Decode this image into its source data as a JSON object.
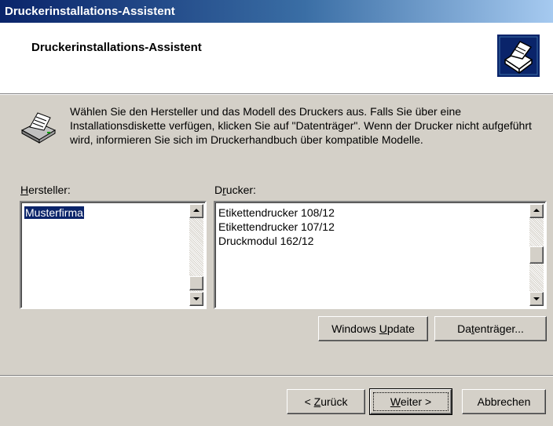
{
  "window": {
    "title": "Druckerinstallations-Assistent"
  },
  "header": {
    "title": "Druckerinstallations-Assistent",
    "icon": "printer-wizard-icon"
  },
  "intro": {
    "icon": "printer-icon",
    "text": "Wählen Sie den Hersteller und das Modell des Druckers aus. Falls Sie über eine Installationsdiskette verfügen, klicken Sie auf \"Datenträger\". Wenn der Drucker nicht aufgeführt wird, informieren Sie sich im Druckerhandbuch über kompatible Modelle."
  },
  "manufacturers": {
    "label_mnemonic": "H",
    "label_rest": "ersteller:",
    "items": [
      {
        "label": "Musterfirma",
        "selected": true
      }
    ]
  },
  "printers": {
    "label_pre": "D",
    "label_mnemonic": "r",
    "label_rest": "ucker:",
    "items": [
      {
        "label": "Etikettendrucker 108/12"
      },
      {
        "label": "Etikettendrucker 107/12"
      },
      {
        "label": "Druckmodul 162/12"
      }
    ]
  },
  "actions": {
    "windows_update_pre": "Windows ",
    "windows_update_mnemonic": "U",
    "windows_update_rest": "pdate",
    "disk_pre": "Da",
    "disk_mnemonic": "t",
    "disk_rest": "enträger..."
  },
  "footer": {
    "back_pre": "< ",
    "back_mnemonic": "Z",
    "back_rest": "urück",
    "next_mnemonic": "W",
    "next_rest": "eiter >",
    "cancel_label": "Abbrechen"
  },
  "colors": {
    "selection": "#0a246a",
    "face": "#d4d0c8"
  }
}
